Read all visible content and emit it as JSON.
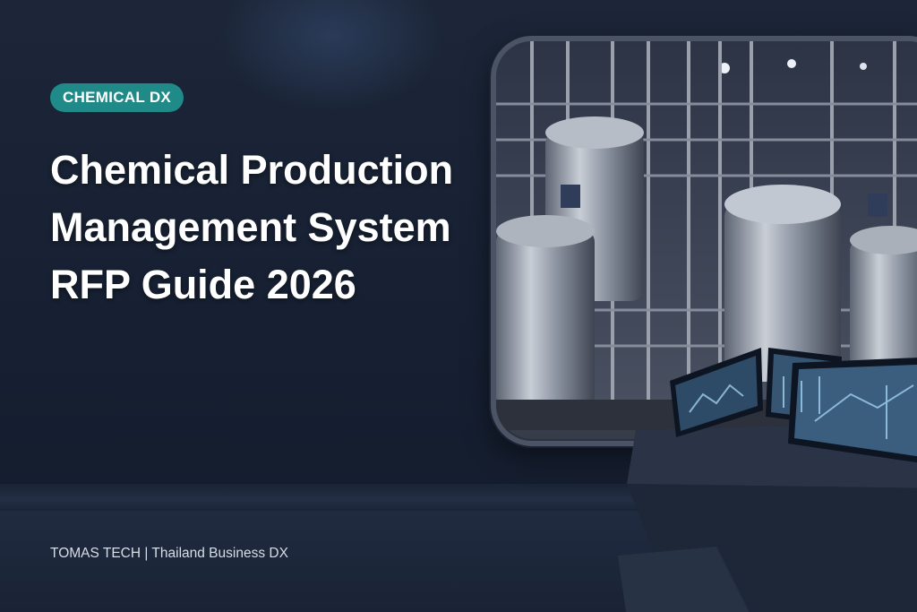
{
  "tag": "CHEMICAL DX",
  "title_lines": [
    "Chemical Production",
    "Management System",
    "RFP Guide 2026"
  ],
  "footer": "TOMAS TECH | Thailand Business DX",
  "colors": {
    "background": "#162032",
    "tag_background": "#1f8a87",
    "title_text": "#ffffff",
    "footer_text": "#d8dde6"
  },
  "illustration": {
    "window_scene": "stainless-steel-chemical-tanks-and-piping",
    "console_scene": "control-console-with-three-monitors"
  }
}
